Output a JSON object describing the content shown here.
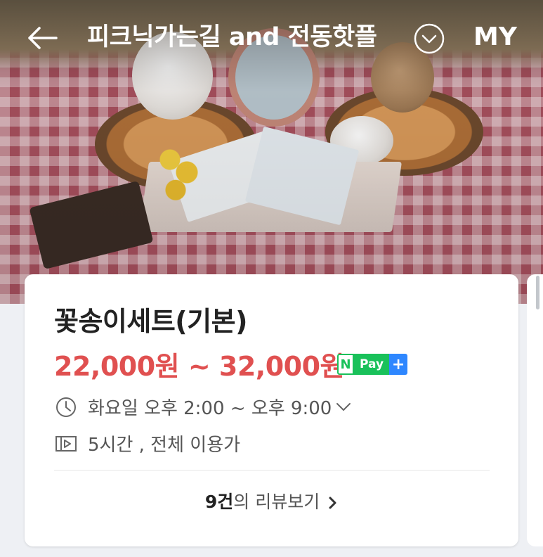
{
  "header": {
    "title": "피크닉가는길 and 전동핫플",
    "my_label": "MY"
  },
  "product": {
    "name": "꽃송이세트(기본)",
    "price_range": "22,000원 ~ 32,000원",
    "npay": {
      "n": "N",
      "pay": "Pay",
      "plus": "+"
    },
    "hours": "화요일 오후 2:00 ~ 오후 9:00",
    "duration": "5시간 , 전체 이용가",
    "reviews": {
      "count": "9건",
      "suffix": "의 리뷰보기"
    }
  },
  "icons": {
    "back": "back-arrow-icon",
    "dropdown": "chevron-down-circle-icon",
    "clock": "clock-icon",
    "expand": "chevron-down-icon",
    "ticket": "ticket-icon",
    "chevron_right": "chevron-right-icon"
  },
  "colors": {
    "price": "#e05050",
    "npay_green": "#19c15a",
    "npay_blue": "#2e87ff",
    "text_dark": "#222222",
    "text_muted": "#555555"
  }
}
